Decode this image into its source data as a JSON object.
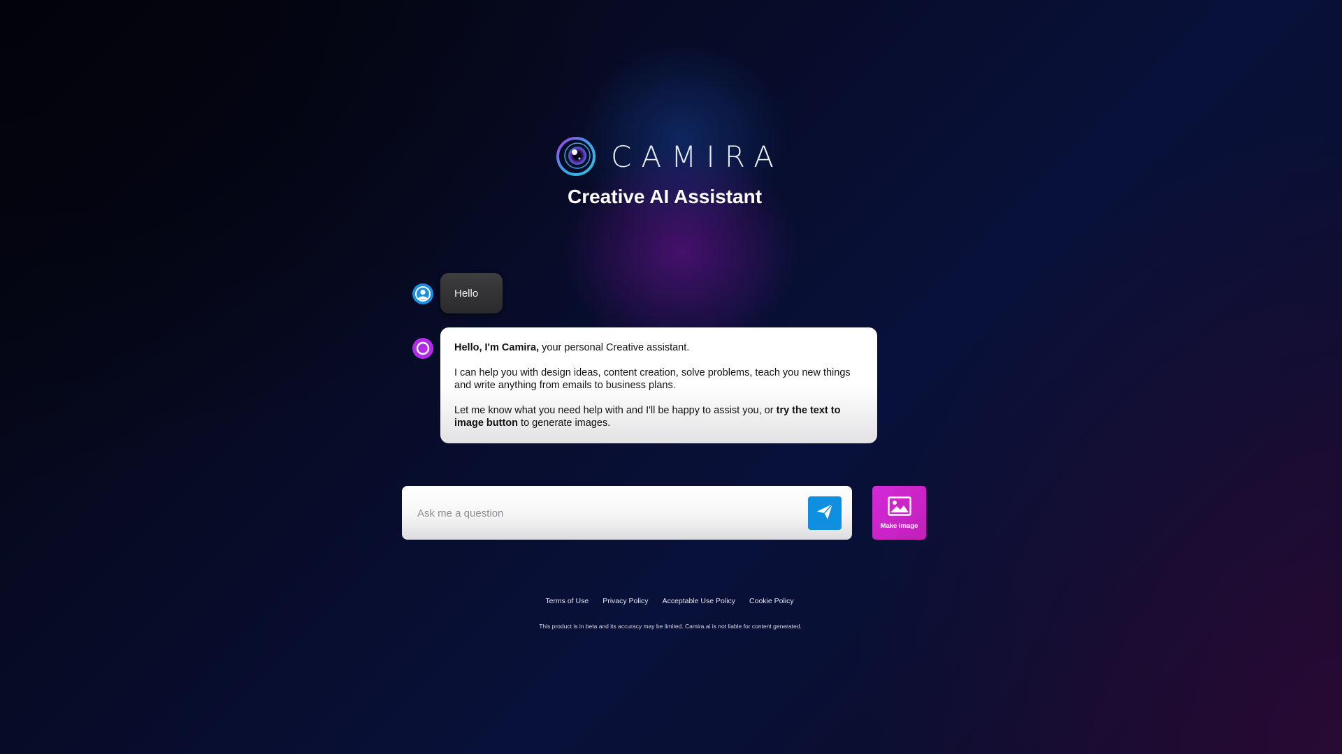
{
  "brand": {
    "name": "CAMIRA",
    "subtitle": "Creative AI Assistant",
    "logo_icon": "camera-lens-eye-icon"
  },
  "chat": {
    "user_message": "Hello",
    "user_avatar_icon": "user-avatar-icon",
    "bot_avatar_icon": "assistant-ring-icon",
    "bot_message": {
      "p1_bold": "Hello, I'm Camira,",
      "p1_rest": " your personal Creative assistant.",
      "p2": "I can help you with design ideas, content creation, solve problems, teach you new things and write anything from emails to business plans.",
      "p3_start": "Let me know what you need help with and I'll be happy to assist you, or ",
      "p3_bold": "try the text to image button",
      "p3_end": " to generate images."
    }
  },
  "input": {
    "placeholder": "Ask me a question",
    "value": "",
    "send_icon": "paper-plane-icon"
  },
  "make_image": {
    "label": "Make Image",
    "icon": "image-icon"
  },
  "footer": {
    "links": [
      "Terms of Use",
      "Privacy Policy",
      "Acceptable Use Policy",
      "Cookie Policy"
    ],
    "disclaimer": "This product is in beta and its accuracy may be limited. Camira.ai is not liable for content generated."
  },
  "colors": {
    "send_button": "#0f8fe0",
    "make_image_button": "#d42ad8",
    "user_avatar": "#1e8fe0",
    "bot_avatar": "#b02ce6"
  }
}
